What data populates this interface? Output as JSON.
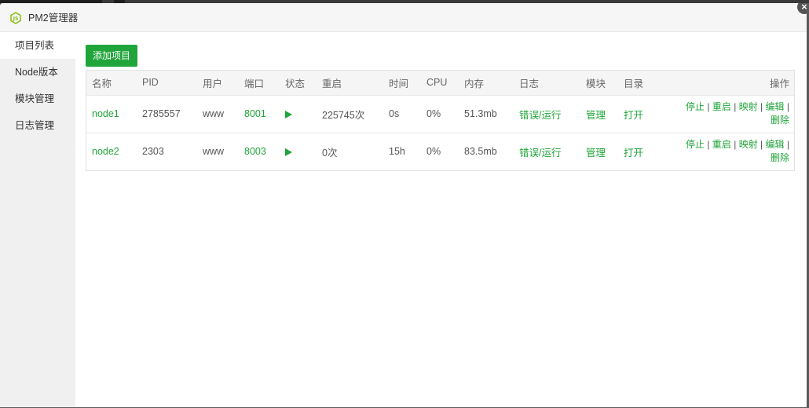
{
  "window": {
    "title": "PM2管理器"
  },
  "sidebar": {
    "items": [
      {
        "label": "项目列表"
      },
      {
        "label": "Node版本"
      },
      {
        "label": "模块管理"
      },
      {
        "label": "日志管理"
      }
    ]
  },
  "toolbar": {
    "add_label": "添加项目"
  },
  "table": {
    "headers": [
      "名称",
      "PID",
      "用户",
      "端口",
      "状态",
      "重启",
      "时间",
      "CPU",
      "内存",
      "日志",
      "模块",
      "目录",
      "操作"
    ],
    "rows": [
      {
        "name": "node1",
        "pid": "2785557",
        "user": "www",
        "port": "8001",
        "status": "running",
        "restarts": "225745次",
        "time": "0s",
        "cpu": "0%",
        "memory": "51.3mb",
        "log": "错误/运行",
        "module": "管理",
        "dir": "打开",
        "ops": [
          "停止",
          "重启",
          "映射",
          "编辑",
          "删除"
        ]
      },
      {
        "name": "node2",
        "pid": "2303",
        "user": "www",
        "port": "8003",
        "status": "running",
        "restarts": "0次",
        "time": "15h",
        "cpu": "0%",
        "memory": "83.5mb",
        "log": "错误/运行",
        "module": "管理",
        "dir": "打开",
        "ops": [
          "停止",
          "重启",
          "映射",
          "编辑",
          "删除"
        ]
      }
    ]
  },
  "colors": {
    "accent": "#20a53a",
    "sidebar_bg": "#f0f0f0",
    "header_bg": "#f5f5f5"
  },
  "icons": {
    "app": "nodejs-icon",
    "close": "close-icon",
    "status": "play-icon"
  }
}
